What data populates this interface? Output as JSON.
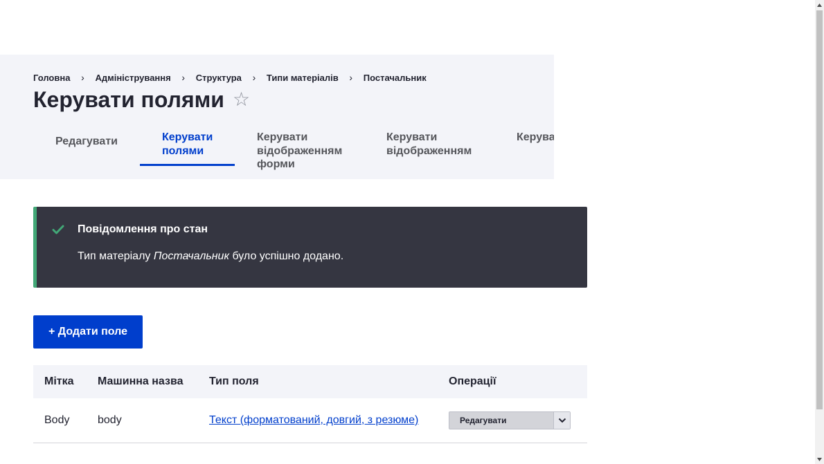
{
  "breadcrumb": [
    {
      "label": "Головна"
    },
    {
      "label": "Адміністрування"
    },
    {
      "label": "Структура"
    },
    {
      "label": "Типи матеріалів"
    },
    {
      "label": "Постачальник"
    }
  ],
  "breadcrumb_separator": "›",
  "page_title": "Керувати полями",
  "favorite_icon": "☆",
  "tabs": [
    {
      "label": "Редагувати"
    },
    {
      "label": "Керувати полями"
    },
    {
      "label": "Керувати відображенням форми"
    },
    {
      "label": "Керувати відображенням"
    },
    {
      "label": "Керувати повнов"
    }
  ],
  "active_tab": 1,
  "status": {
    "title": "Повідомлення про стан",
    "text_before": "Тип матеріалу ",
    "text_em": "Постачальник",
    "text_after": " було успішно додано.",
    "icon": "check-icon",
    "accent_color": "#42a877"
  },
  "add_field_label": "+ Додати поле",
  "table": {
    "headers": [
      "Мітка",
      "Машинна назва",
      "Тип поля",
      "Операції"
    ],
    "rows": [
      {
        "label": "Body",
        "machine_name": "body",
        "field_type": "Текст (форматований, довгий, з резюме)",
        "operation": "Редагувати"
      }
    ]
  },
  "colors": {
    "primary": "#003ecc",
    "header_bg": "#f3f4f9",
    "status_bg": "#353641"
  }
}
